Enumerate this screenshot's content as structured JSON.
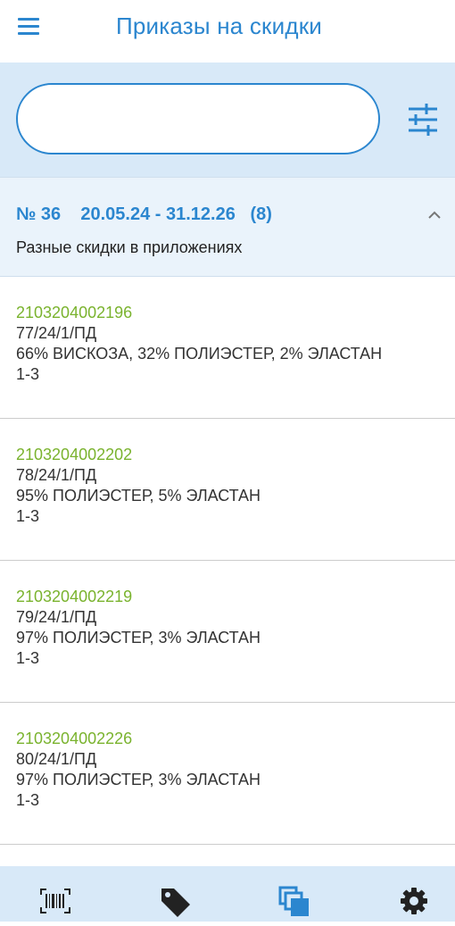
{
  "header": {
    "title": "Приказы на скидки",
    "menu_icon": "hamburger-menu-icon"
  },
  "search": {
    "value": "",
    "placeholder": "",
    "filter_icon": "filter-sliders-icon"
  },
  "order": {
    "number": "№ 36",
    "period": "20.05.24 - 31.12.26",
    "count": "(8)",
    "description": "Разные скидки в приложениях",
    "expanded": true
  },
  "items": [
    {
      "code": "2103204002196",
      "article": "77/24/1/ПД",
      "composition": "66% ВИСКОЗА, 32% ПОЛИЭСТЕР, 2% ЭЛАСТАН",
      "range": "1-3"
    },
    {
      "code": "2103204002202",
      "article": "78/24/1/ПД",
      "composition": "95% ПОЛИЭСТЕР, 5% ЭЛАСТАН",
      "range": "1-3"
    },
    {
      "code": "2103204002219",
      "article": "79/24/1/ПД",
      "composition": "97% ПОЛИЭСТЕР, 3% ЭЛАСТАН",
      "range": "1-3"
    },
    {
      "code": "2103204002226",
      "article": "80/24/1/ПД",
      "composition": "97% ПОЛИЭСТЕР, 3% ЭЛАСТАН",
      "range": "1-3"
    }
  ],
  "bottom_nav": [
    "barcode-scanner-icon",
    "price-tag-icon",
    "copy-documents-icon",
    "settings-gear-icon"
  ],
  "colors": {
    "accent": "#2b86cf",
    "code_green": "#7ab32e",
    "band_bg": "#d8e9f8",
    "header_bg": "#eaf3fb"
  }
}
